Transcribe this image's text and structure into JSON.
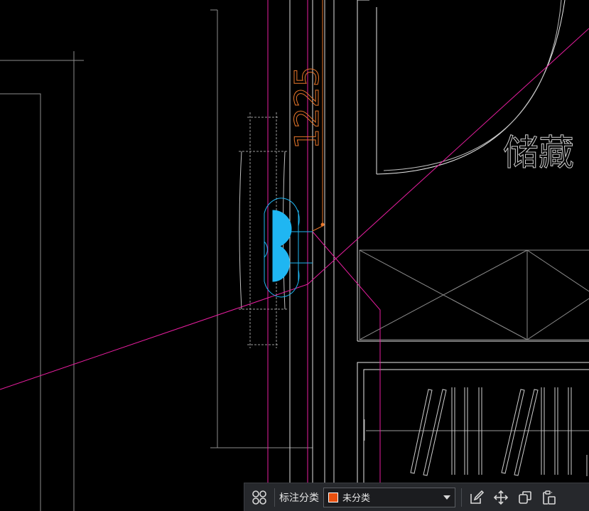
{
  "colors": {
    "background": "#000000",
    "white_line": "#e8e8e8",
    "grey_line": "#8c8c8c",
    "magenta_line": "#e91ea0",
    "orange_dim": "#e8762a",
    "cyan_fixture": "#1fb6f2",
    "toolbar_bg": "#26282c",
    "category_swatch": "#e8500f"
  },
  "drawing": {
    "dimension_text": "1225",
    "room_label": "储藏"
  },
  "toolbar": {
    "grid_icon": "grid-four-circles-icon",
    "category_label": "标注分类",
    "category_value": "未分类",
    "edit_icon": "edit-pen-icon",
    "move_icon": "move-arrows-icon",
    "copy_icon": "copy-icon",
    "paste_icon": "paste-clipboard-icon"
  }
}
